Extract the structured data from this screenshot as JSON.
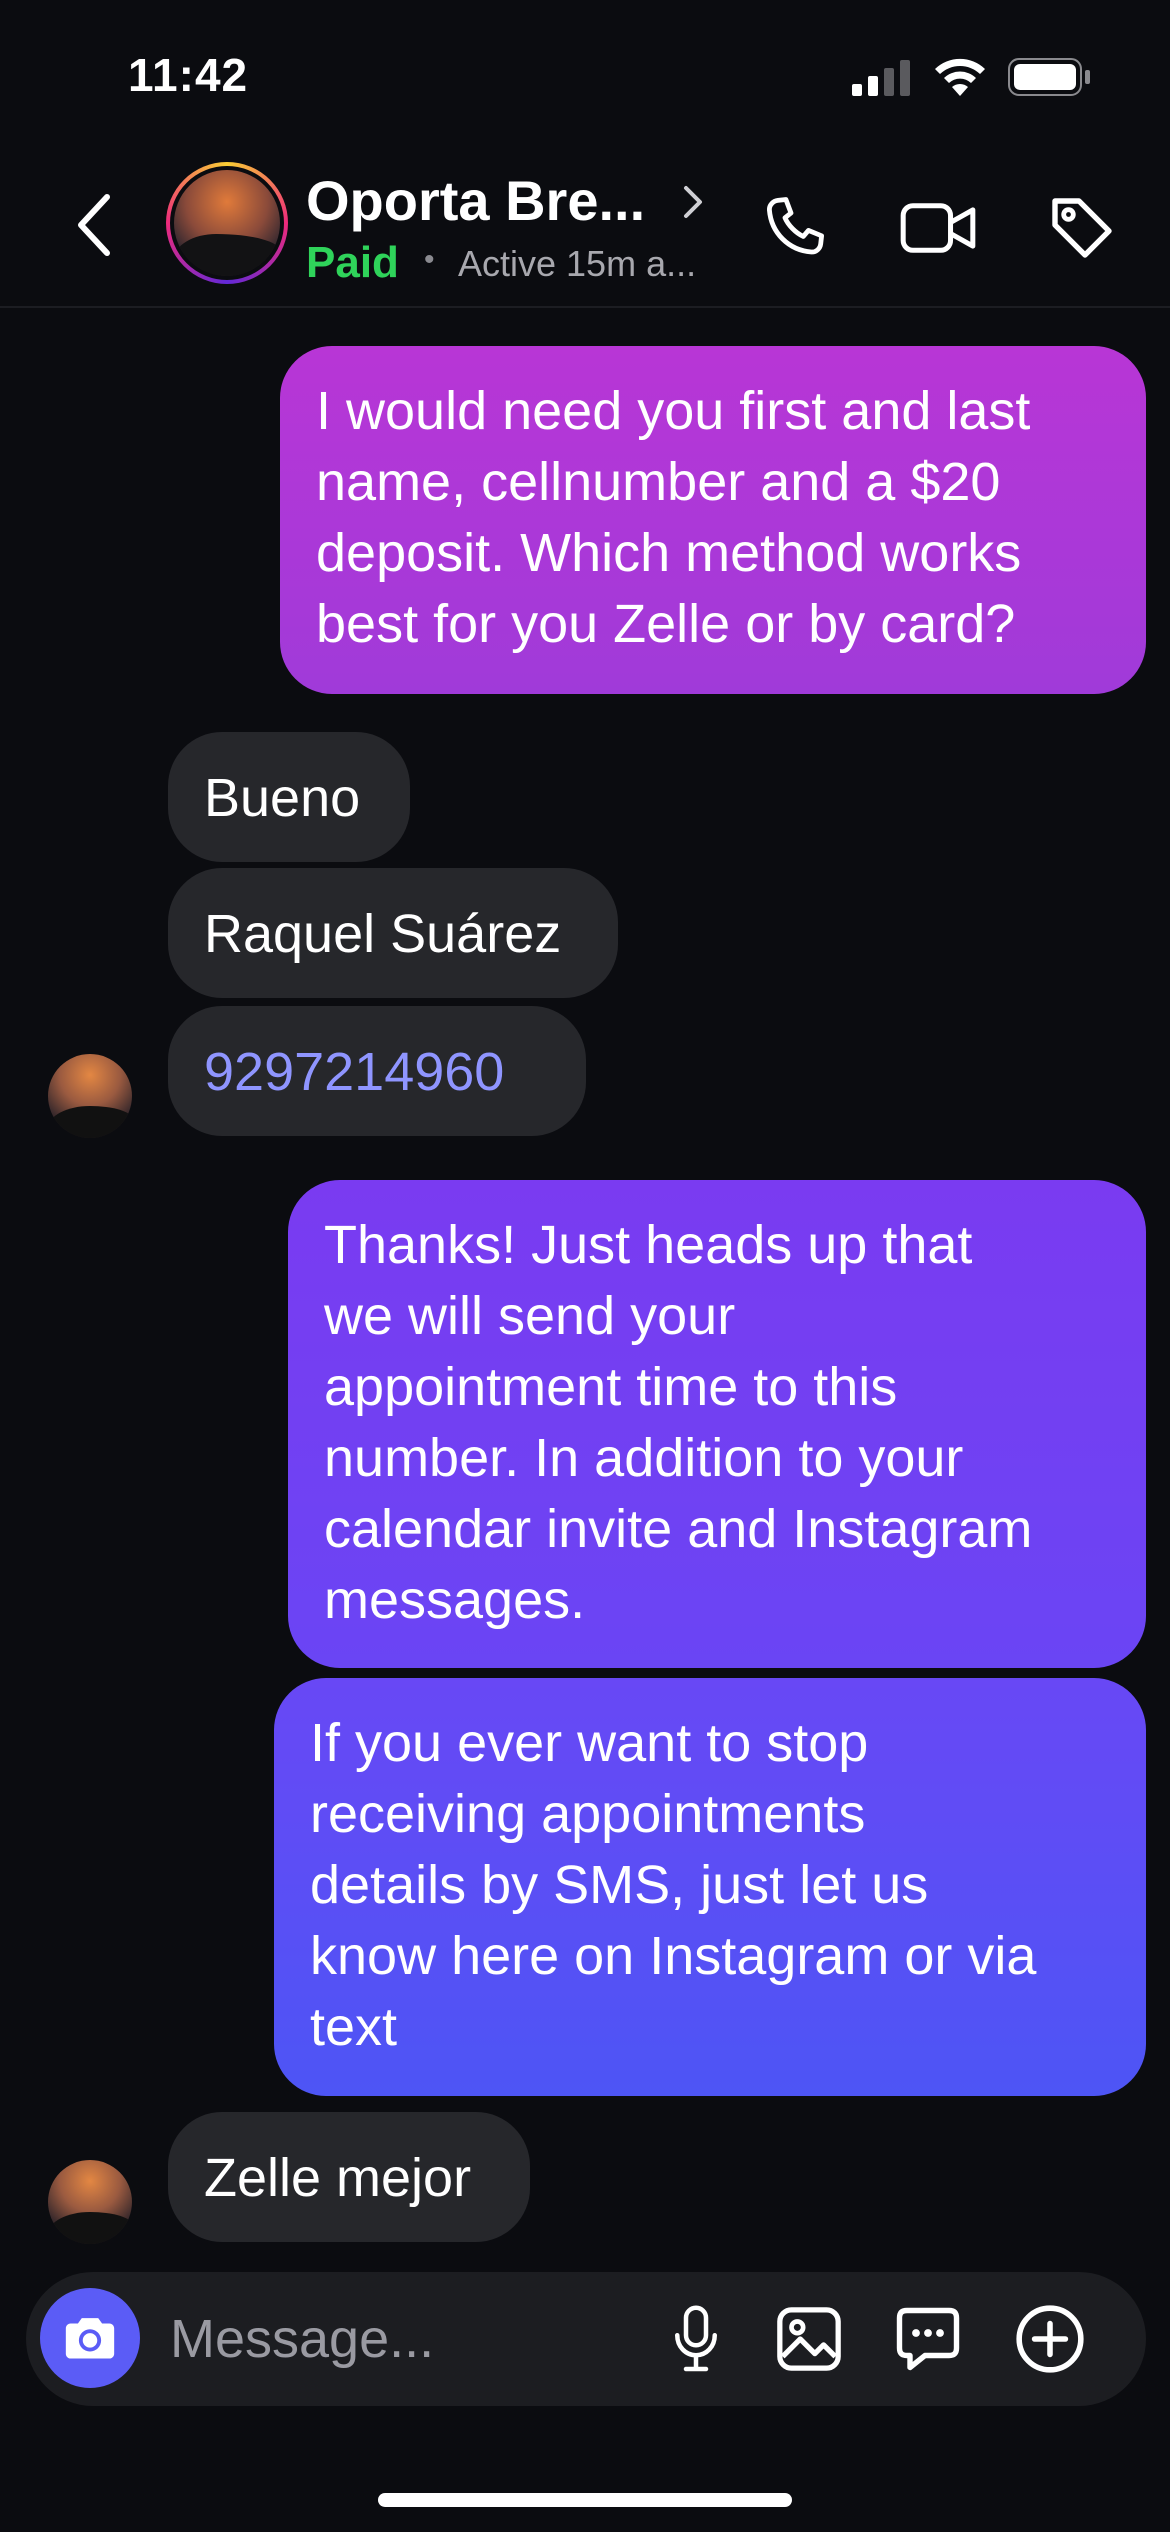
{
  "status_bar": {
    "time": "11:42"
  },
  "header": {
    "contact_name": "Oporta Bre...",
    "tag": "Paid",
    "separator": "•",
    "activity": "Active 15m a...",
    "icons": [
      "back-icon",
      "chevron-right-icon",
      "phone-icon",
      "video-icon",
      "tag-icon"
    ]
  },
  "messages": [
    {
      "from": "me",
      "text": "I would need you first and last\nname, cellnumber and a $20\ndeposit. Which method works\nbest for you Zelle or by card?"
    },
    {
      "from": "them",
      "text": "Bueno"
    },
    {
      "from": "them",
      "text": "Raquel Suárez"
    },
    {
      "from": "them",
      "text": "9297214960",
      "is_link": true
    },
    {
      "from": "me",
      "text": "Thanks! Just heads up that\nwe will send your\nappointment time to this\nnumber. In addition to your\ncalendar invite and Instagram\nmessages."
    },
    {
      "from": "me",
      "text": "If you ever want to stop\nreceiving appointments\ndetails by SMS, just let us\nknow here on Instagram or via\ntext"
    },
    {
      "from": "them",
      "text": "Zelle mejor"
    }
  ],
  "composer": {
    "placeholder": "Message...",
    "icons": [
      "camera-icon",
      "microphone-icon",
      "gallery-icon",
      "sticker-icon",
      "add-icon"
    ]
  },
  "colors": {
    "background": "#0b0c10",
    "incoming_bubble": "#26272b",
    "outgoing_gradient_top": "#b535d8",
    "outgoing_gradient_bottom": "#4d55f5",
    "paid_green": "#2fd35a",
    "link": "#8f95ff",
    "camera_button": "#5b5cf6"
  }
}
